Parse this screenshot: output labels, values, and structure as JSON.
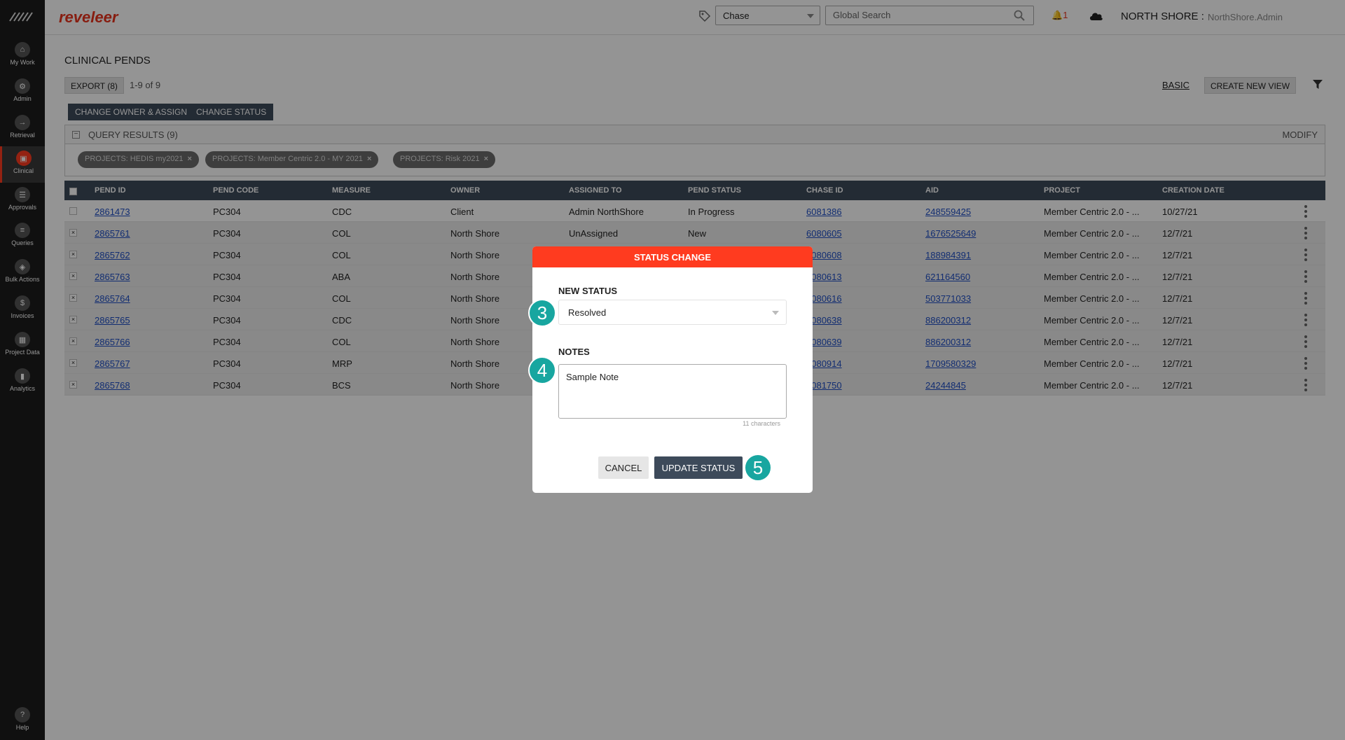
{
  "sidebar": {
    "items": [
      {
        "label": "My Work",
        "icon": "home-icon",
        "active": false
      },
      {
        "label": "Admin",
        "icon": "gear-icon",
        "active": false
      },
      {
        "label": "Retrieval",
        "icon": "arrow-right-icon",
        "active": false
      },
      {
        "label": "Clinical",
        "icon": "clipboard-icon",
        "active": true
      },
      {
        "label": "Approvals",
        "icon": "list-icon",
        "active": false
      },
      {
        "label": "Queries",
        "icon": "document-icon",
        "active": false
      },
      {
        "label": "Bulk Actions",
        "icon": "layers-icon",
        "active": false
      },
      {
        "label": "Invoices",
        "icon": "dollar-icon",
        "active": false
      },
      {
        "label": "Project Data",
        "icon": "grid-icon",
        "active": false
      },
      {
        "label": "Analytics",
        "icon": "chart-icon",
        "active": false
      }
    ],
    "help_label": "Help"
  },
  "header": {
    "brand": "reveleer",
    "search_type": "Chase",
    "search_placeholder": "Global Search",
    "notification_count": "1",
    "org_name": "NORTH SHORE :",
    "user_name": "NorthShore.Admin"
  },
  "page": {
    "title": "CLINICAL PENDS",
    "export_label": "EXPORT (8)",
    "range_text": "1-9  of  9",
    "basic_label": "BASIC",
    "create_view_label": "CREATE NEW VIEW",
    "change_owner_label": "CHANGE OWNER & ASSIGN",
    "change_status_label": "CHANGE STATUS"
  },
  "query": {
    "label": "QUERY RESULTS (9)",
    "modify_label": "MODIFY",
    "chips": [
      {
        "prefix": "PROJECTS:",
        "value": "HEDIS my2021"
      },
      {
        "prefix": "PROJECTS:",
        "value": "Member Centric 2.0 - MY 2021"
      },
      {
        "prefix": "PROJECTS:",
        "value": "Risk 2021"
      }
    ]
  },
  "table": {
    "columns": [
      "PEND ID",
      "PEND CODE",
      "MEASURE",
      "OWNER",
      "ASSIGNED TO",
      "PEND STATUS",
      "CHASE ID",
      "AID",
      "PROJECT",
      "CREATION DATE"
    ],
    "rows": [
      {
        "selected": false,
        "pend_id": "2861473",
        "pend_code": "PC304",
        "measure": "CDC",
        "owner": "Client",
        "assigned_to": "Admin NorthShore",
        "status": "In Progress",
        "chase_id": "6081386",
        "aid": "248559425",
        "project": "Member Centric 2.0 - ...",
        "date": "10/27/21"
      },
      {
        "selected": true,
        "pend_id": "2865761",
        "pend_code": "PC304",
        "measure": "COL",
        "owner": "North Shore",
        "assigned_to": "UnAssigned",
        "status": "New",
        "chase_id": "6080605",
        "aid": "1676525649",
        "project": "Member Centric 2.0 - ...",
        "date": "12/7/21"
      },
      {
        "selected": true,
        "pend_id": "2865762",
        "pend_code": "PC304",
        "measure": "COL",
        "owner": "North Shore",
        "assigned_to": "",
        "status": "",
        "chase_id": "6080608",
        "aid": "188984391",
        "project": "Member Centric 2.0 - ...",
        "date": "12/7/21"
      },
      {
        "selected": true,
        "pend_id": "2865763",
        "pend_code": "PC304",
        "measure": "ABA",
        "owner": "North Shore",
        "assigned_to": "",
        "status": "",
        "chase_id": "6080613",
        "aid": "621164560",
        "project": "Member Centric 2.0 - ...",
        "date": "12/7/21"
      },
      {
        "selected": true,
        "pend_id": "2865764",
        "pend_code": "PC304",
        "measure": "COL",
        "owner": "North Shore",
        "assigned_to": "",
        "status": "",
        "chase_id": "6080616",
        "aid": "503771033",
        "project": "Member Centric 2.0 - ...",
        "date": "12/7/21"
      },
      {
        "selected": true,
        "pend_id": "2865765",
        "pend_code": "PC304",
        "measure": "CDC",
        "owner": "North Shore",
        "assigned_to": "",
        "status": "",
        "chase_id": "6080638",
        "aid": "886200312",
        "project": "Member Centric 2.0 - ...",
        "date": "12/7/21"
      },
      {
        "selected": true,
        "pend_id": "2865766",
        "pend_code": "PC304",
        "measure": "COL",
        "owner": "North Shore",
        "assigned_to": "",
        "status": "",
        "chase_id": "6080639",
        "aid": "886200312",
        "project": "Member Centric 2.0 - ...",
        "date": "12/7/21"
      },
      {
        "selected": true,
        "pend_id": "2865767",
        "pend_code": "PC304",
        "measure": "MRP",
        "owner": "North Shore",
        "assigned_to": "",
        "status": "",
        "chase_id": "6080914",
        "aid": "1709580329",
        "project": "Member Centric 2.0 - ...",
        "date": "12/7/21"
      },
      {
        "selected": true,
        "pend_id": "2865768",
        "pend_code": "PC304",
        "measure": "BCS",
        "owner": "North Shore",
        "assigned_to": "",
        "status": "",
        "chase_id": "6081750",
        "aid": "24244845",
        "project": "Member Centric 2.0 - ...",
        "date": "12/7/21"
      }
    ]
  },
  "modal": {
    "title": "STATUS CHANGE",
    "new_status_label": "NEW STATUS",
    "status_value": "Resolved",
    "notes_label": "NOTES",
    "notes_value": "Sample Note",
    "char_count": "11 characters",
    "cancel_label": "CANCEL",
    "update_label": "UPDATE STATUS"
  },
  "steps": [
    "3",
    "4",
    "5"
  ],
  "colors": {
    "accent": "#ff3b1f",
    "dark_button": "#3d4a5a",
    "step_badge": "#18a6a0",
    "link": "#1f4fc4"
  }
}
